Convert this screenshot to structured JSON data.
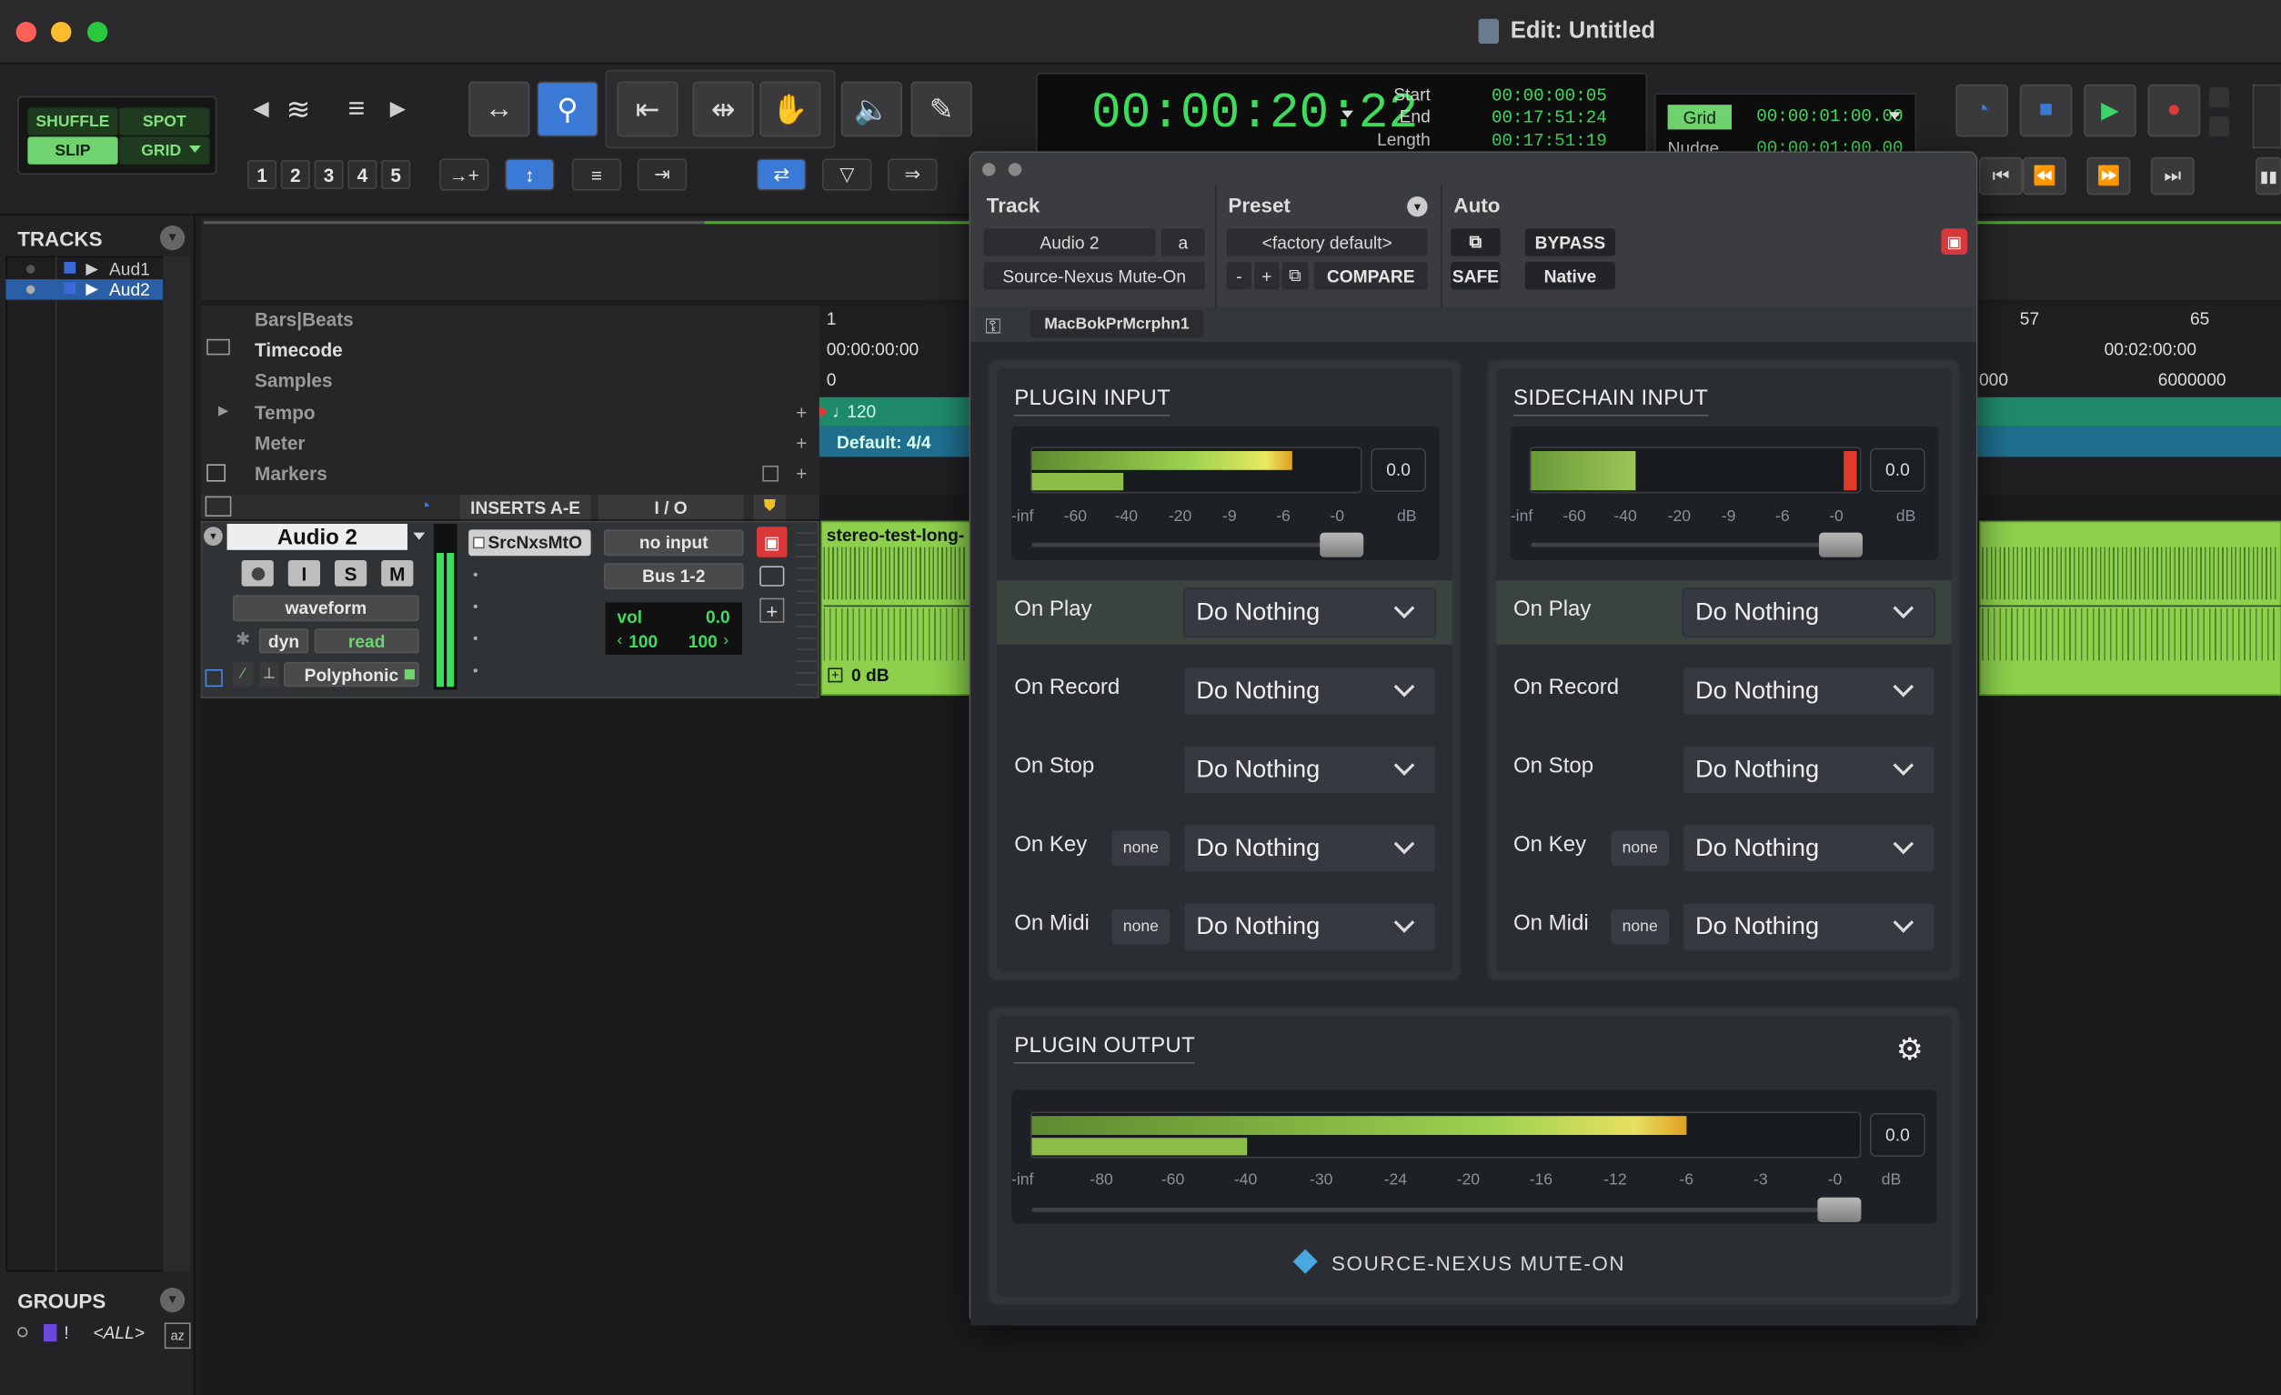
{
  "window": {
    "title": "Edit: Untitled"
  },
  "modes": {
    "shuffle": "SHUFFLE",
    "spot": "SPOT",
    "slip": "SLIP",
    "grid": "GRID"
  },
  "zoom_presets": [
    "1",
    "2",
    "3",
    "4",
    "5"
  ],
  "counter": {
    "main": "00:00:20:22",
    "start_label": "Start",
    "end_label": "End",
    "length_label": "Length",
    "start": "00:00:00:05",
    "end": "00:17:51:24",
    "length": "00:17:51:19"
  },
  "grid": {
    "label": "Grid",
    "value": "00:00:01:00.00",
    "nudge_label": "Nudge",
    "nudge_value": "00:00:01:00.00"
  },
  "tracks_panel": {
    "title": "TRACKS",
    "items": [
      {
        "name": "Aud1"
      },
      {
        "name": "Aud2"
      }
    ]
  },
  "groups_panel": {
    "title": "GROUPS",
    "all": "<ALL>"
  },
  "rulers": {
    "bars": "Bars|Beats",
    "timecode": "Timecode",
    "samples": "Samples",
    "tempo": "Tempo",
    "meter": "Meter",
    "markers": "Markers",
    "bars_start": "1",
    "bars_57": "57",
    "bars_65": "65",
    "tc_start": "00:00:00:00",
    "tc_2min": "00:02:00:00",
    "samples_start": "0",
    "samples_mid": "000",
    "samples_6m": "6000000",
    "tempo_value": "120",
    "meter_value": "Default: 4/4"
  },
  "mix_header": {
    "inserts": "INSERTS A-E",
    "io": "I / O"
  },
  "track": {
    "name": "Audio 2",
    "rec": "",
    "input": "I",
    "solo": "S",
    "mute": "M",
    "view": "waveform",
    "dyn": "dyn",
    "automation": "read",
    "elastic": "Polyphonic",
    "insert": "SrcNxsMtO",
    "input_sel": "no input",
    "output_sel": "Bus 1-2",
    "vol_label": "vol",
    "vol_value": "0.0",
    "pan_l": "100",
    "pan_r": "100",
    "clip_name": "stereo-test-long-",
    "clip_gain": "0 dB"
  },
  "plugin": {
    "track_label": "Track",
    "preset_label": "Preset",
    "auto_label": "Auto",
    "track_name": "Audio 2",
    "track_ch": "a",
    "plugin_name": "Source-Nexus Mute-On",
    "preset_name": "<factory default>",
    "minus": "-",
    "plus": "+",
    "compare": "COMPARE",
    "bypass": "BYPASS",
    "safe": "SAFE",
    "native": "Native",
    "machine": "MacBokPrMcrphn1",
    "input": {
      "title": "PLUGIN INPUT",
      "value": "0.0",
      "level": 0.79,
      "level2": 0.28,
      "scale": [
        "-inf",
        "-60",
        "-40",
        "-20",
        "-9",
        "-6",
        "-0",
        "dB"
      ],
      "events": [
        {
          "label": "On Play",
          "action": "Do Nothing"
        },
        {
          "label": "On Record",
          "action": "Do Nothing"
        },
        {
          "label": "On Stop",
          "action": "Do Nothing"
        },
        {
          "label": "On Key",
          "tag": "none",
          "action": "Do Nothing"
        },
        {
          "label": "On Midi",
          "tag": "none",
          "action": "Do Nothing"
        }
      ]
    },
    "sidechain": {
      "title": "SIDECHAIN INPUT",
      "value": "0.0",
      "level": 0.32,
      "scale": [
        "-inf",
        "-60",
        "-40",
        "-20",
        "-9",
        "-6",
        "-0",
        "dB"
      ],
      "events": [
        {
          "label": "On Play",
          "action": "Do Nothing"
        },
        {
          "label": "On Record",
          "action": "Do Nothing"
        },
        {
          "label": "On Stop",
          "action": "Do Nothing"
        },
        {
          "label": "On Key",
          "tag": "none",
          "action": "Do Nothing"
        },
        {
          "label": "On Midi",
          "tag": "none",
          "action": "Do Nothing"
        }
      ]
    },
    "output": {
      "title": "PLUGIN OUTPUT",
      "value": "0.0",
      "level": 0.79,
      "level2": 0.26,
      "scale": [
        "-inf",
        "-80",
        "-60",
        "-40",
        "-30",
        "-24",
        "-20",
        "-16",
        "-12",
        "-6",
        "-3",
        "-0",
        "dB"
      ]
    },
    "brand": "SOURCE-NEXUS MUTE-ON"
  },
  "colors": {
    "accent_green": "#3ddc5b",
    "play": "#3ad36a",
    "record": "#e03a3a",
    "brand_blue": "#4aa8e0"
  }
}
